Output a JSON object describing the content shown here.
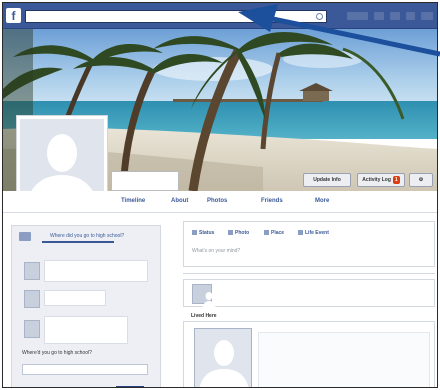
{
  "topbar": {
    "logo": "f",
    "search_value": "",
    "brand_color": "#3b5998"
  },
  "cover": {
    "update_info_label": "Update Info",
    "activity_log_label": "Activity Log",
    "activity_count": "1"
  },
  "profile": {
    "name": ""
  },
  "nav": {
    "tabs": [
      "Timeline",
      "About",
      "Photos",
      "Friends",
      "More"
    ]
  },
  "left_column": {
    "header": "Where did you go to high school?",
    "question": "Where'd you go to high school?",
    "input_placeholder": "",
    "save_label": "",
    "cancel_label": ""
  },
  "composer": {
    "tabs": [
      "Status",
      "Photo",
      "Place",
      "Life Event"
    ],
    "placeholder": "What's on your mind?"
  },
  "feed": {
    "lived_label": "Lived Here"
  },
  "annotation": {
    "arrow_color": "#1c4f9c"
  }
}
